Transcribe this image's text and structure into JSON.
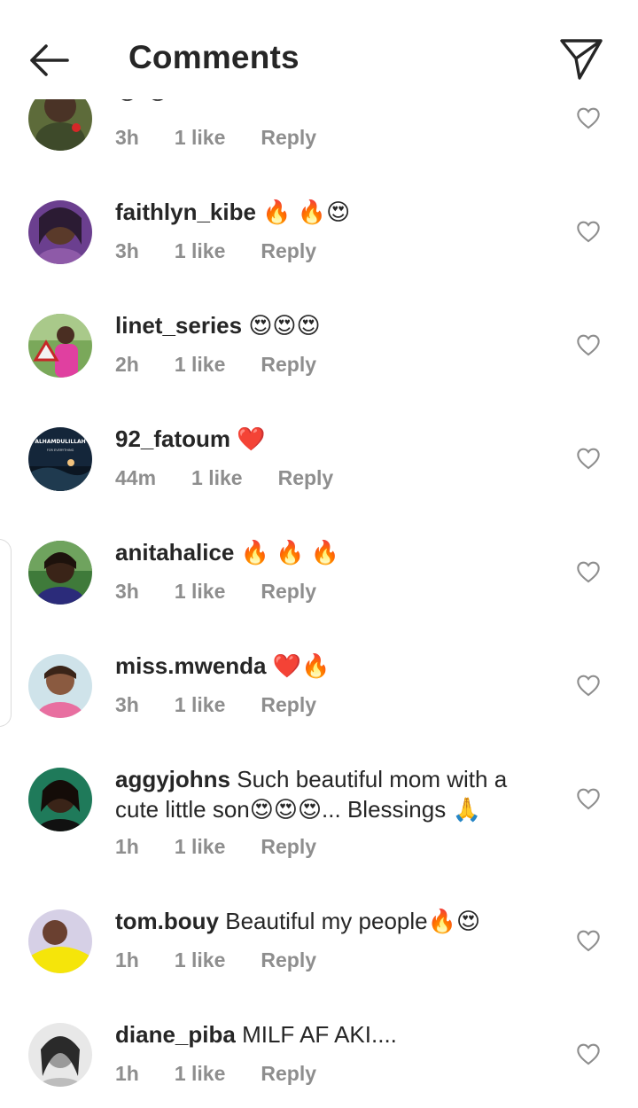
{
  "header": {
    "title": "Comments",
    "back_icon": "arrow-left-icon",
    "send_icon": "paper-plane-icon"
  },
  "comments": [
    {
      "username": "",
      "text": "",
      "emoji": "😍 😍",
      "time": "3h",
      "likes": "1 like",
      "reply": "Reply"
    },
    {
      "username": "faithlyn_kibe",
      "text": "",
      "emoji": "🔥 🔥😍",
      "time": "3h",
      "likes": "1 like",
      "reply": "Reply"
    },
    {
      "username": "linet_series",
      "text": "",
      "emoji": "😍😍😍",
      "time": "2h",
      "likes": "1 like",
      "reply": "Reply"
    },
    {
      "username": "92_fatoum",
      "text": "",
      "emoji": "❤️",
      "time": "44m",
      "likes": "1 like",
      "reply": "Reply"
    },
    {
      "username": "anitahalice",
      "text": "",
      "emoji": "🔥 🔥 🔥",
      "time": "3h",
      "likes": "1 like",
      "reply": "Reply"
    },
    {
      "username": "miss.mwenda",
      "text": "",
      "emoji": "❤️🔥",
      "time": "3h",
      "likes": "1 like",
      "reply": "Reply"
    },
    {
      "username": "aggyjohns",
      "text": "Such beautiful mom with a",
      "text2": "cute little son😍😍😍... Blessings 🙏",
      "time": "1h",
      "likes": "1 like",
      "reply": "Reply"
    },
    {
      "username": "tom.bouy",
      "text": "Beautiful my people🔥😍",
      "time": "1h",
      "likes": "1 like",
      "reply": "Reply"
    },
    {
      "username": "diane_piba",
      "text": "MILF AF AKI....",
      "time": "1h",
      "likes": "1 like",
      "reply": "Reply"
    }
  ],
  "avatar_texts": {
    "fatoum_banner": "ALHAMDULILLAH",
    "fatoum_sub": "FOR EVERYTHING"
  },
  "colors": {
    "text": "#262626",
    "meta": "#8e8e8e",
    "background": "#ffffff"
  }
}
